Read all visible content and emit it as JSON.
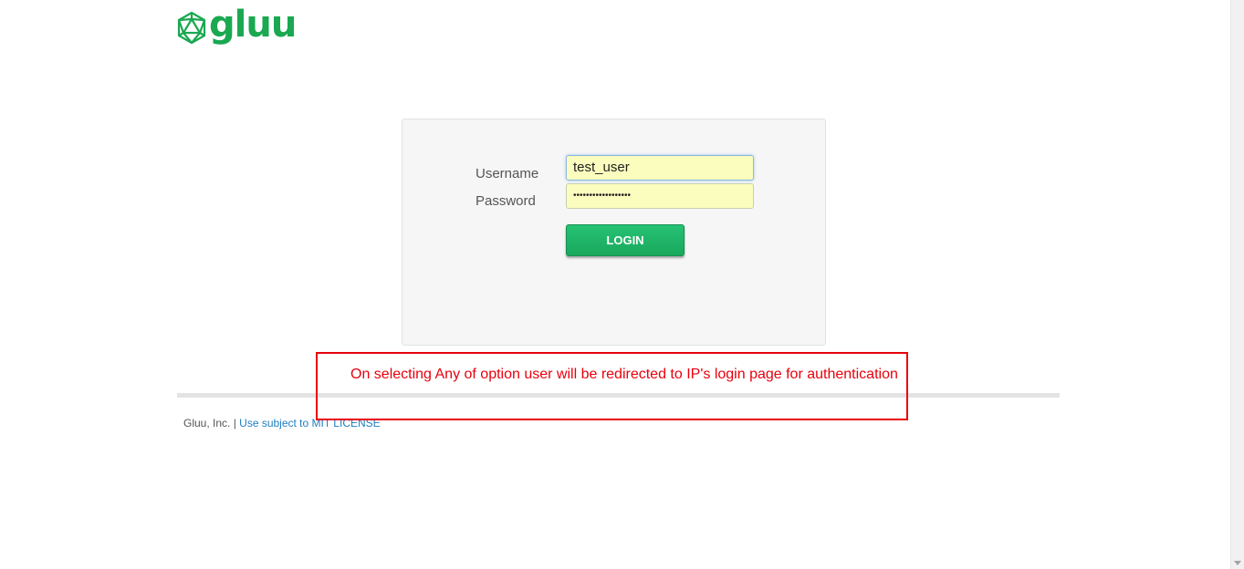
{
  "brand": {
    "name": "gluu",
    "color": "#1aa851"
  },
  "login_form": {
    "username_label": "Username",
    "password_label": "Password",
    "username_value": "test_user",
    "password_value": "••••••••••••••••••",
    "login_button_label": "LOGIN"
  },
  "annotation": {
    "text": "On selecting Any of option user will be redirected to IP's login page for authentication",
    "color": "#e8000d"
  },
  "footer": {
    "company": "Gluu, Inc.",
    "separator": " | ",
    "license_link": "Use subject to MIT LICENSE"
  },
  "colors": {
    "accent_green": "#1aa851",
    "link_blue": "#1f7ebf",
    "input_autofill": "#fbfdbe"
  },
  "icons": {
    "logo": "icosahedron-logo-icon",
    "scroll_down": "chevron-down-icon"
  }
}
